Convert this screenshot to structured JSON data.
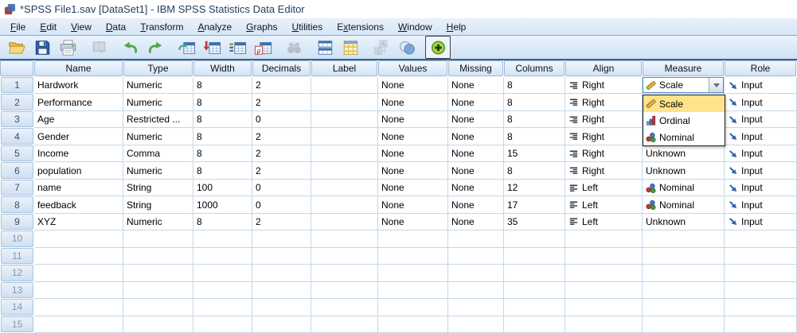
{
  "window": {
    "title": "*SPSS File1.sav [DataSet1] - IBM SPSS Statistics Data Editor",
    "app_icon": "spss-app-icon"
  },
  "menu": {
    "items": [
      {
        "label": "File",
        "underline_index": 0
      },
      {
        "label": "Edit",
        "underline_index": 0
      },
      {
        "label": "View",
        "underline_index": 0
      },
      {
        "label": "Data",
        "underline_index": 0
      },
      {
        "label": "Transform",
        "underline_index": 0
      },
      {
        "label": "Analyze",
        "underline_index": 0
      },
      {
        "label": "Graphs",
        "underline_index": 0
      },
      {
        "label": "Utilities",
        "underline_index": 0
      },
      {
        "label": "Extensions",
        "underline_index": 1
      },
      {
        "label": "Window",
        "underline_index": 0
      },
      {
        "label": "Help",
        "underline_index": 0
      }
    ]
  },
  "toolbar": {
    "buttons": [
      {
        "name": "open-data-button",
        "icon": "open-folder-icon",
        "disabled": false,
        "pressed": false,
        "group_start": false
      },
      {
        "name": "save-button",
        "icon": "save-icon",
        "disabled": false,
        "pressed": false,
        "group_start": false
      },
      {
        "name": "print-button",
        "icon": "print-icon",
        "disabled": false,
        "pressed": false,
        "group_start": false
      },
      {
        "name": "recall-dialogs-button",
        "icon": "recall-dialogs-icon",
        "disabled": true,
        "pressed": false,
        "group_start": true
      },
      {
        "name": "undo-button",
        "icon": "undo-icon",
        "disabled": false,
        "pressed": false,
        "group_start": true
      },
      {
        "name": "redo-button",
        "icon": "redo-icon",
        "disabled": false,
        "pressed": false,
        "group_start": false
      },
      {
        "name": "goto-case-button",
        "icon": "goto-case-icon",
        "disabled": false,
        "pressed": false,
        "group_start": true
      },
      {
        "name": "goto-variable-button",
        "icon": "goto-variable-icon",
        "disabled": false,
        "pressed": false,
        "group_start": false
      },
      {
        "name": "variables-button",
        "icon": "variables-icon",
        "disabled": false,
        "pressed": false,
        "group_start": false
      },
      {
        "name": "descriptives-button",
        "icon": "descriptives-icon",
        "disabled": false,
        "pressed": false,
        "group_start": false
      },
      {
        "name": "find-button",
        "icon": "find-icon",
        "disabled": true,
        "pressed": false,
        "group_start": true
      },
      {
        "name": "split-file-button",
        "icon": "split-file-icon",
        "disabled": false,
        "pressed": false,
        "group_start": true
      },
      {
        "name": "select-cases-button",
        "icon": "select-cases-icon",
        "disabled": false,
        "pressed": false,
        "group_start": false
      },
      {
        "name": "value-labels-button",
        "icon": "value-labels-icon",
        "disabled": true,
        "pressed": false,
        "group_start": true
      },
      {
        "name": "use-variable-sets-button",
        "icon": "use-variable-sets-icon",
        "disabled": false,
        "pressed": false,
        "group_start": false
      },
      {
        "name": "show-all-variables-button",
        "icon": "show-all-variables-icon",
        "disabled": false,
        "pressed": true,
        "group_start": true
      }
    ]
  },
  "grid": {
    "columns": [
      "Name",
      "Type",
      "Width",
      "Decimals",
      "Label",
      "Values",
      "Missing",
      "Columns",
      "Align",
      "Measure",
      "Role"
    ],
    "rows": [
      {
        "number": "1",
        "name": "Hardwork",
        "type": "Numeric",
        "width": "8",
        "decimals": "2",
        "label": "",
        "values": "None",
        "missing": "None",
        "columns": "8",
        "align": "Right",
        "align_icon": "align-right-icon",
        "measure": "Scale",
        "measure_icon": "scale-icon",
        "measure_editor_open": true,
        "role": "Input",
        "role_icon": "input-role-icon"
      },
      {
        "number": "2",
        "name": "Performance",
        "type": "Numeric",
        "width": "8",
        "decimals": "2",
        "label": "",
        "values": "None",
        "missing": "None",
        "columns": "8",
        "align": "Right",
        "align_icon": "align-right-icon",
        "measure": "",
        "measure_icon": null,
        "measure_editor_open": false,
        "role": "Input",
        "role_icon": "input-role-icon"
      },
      {
        "number": "3",
        "name": "Age",
        "type": "Restricted ...",
        "width": "8",
        "decimals": "0",
        "label": "",
        "values": "None",
        "missing": "None",
        "columns": "8",
        "align": "Right",
        "align_icon": "align-right-icon",
        "measure": "",
        "measure_icon": null,
        "measure_editor_open": false,
        "role": "Input",
        "role_icon": "input-role-icon"
      },
      {
        "number": "4",
        "name": "Gender",
        "type": "Numeric",
        "width": "8",
        "decimals": "2",
        "label": "",
        "values": "None",
        "missing": "None",
        "columns": "8",
        "align": "Right",
        "align_icon": "align-right-icon",
        "measure": "",
        "measure_icon": null,
        "measure_editor_open": false,
        "role": "Input",
        "role_icon": "input-role-icon"
      },
      {
        "number": "5",
        "name": "Income",
        "type": "Comma",
        "width": "8",
        "decimals": "2",
        "label": "",
        "values": "None",
        "missing": "None",
        "columns": "15",
        "align": "Right",
        "align_icon": "align-right-icon",
        "measure": "Unknown",
        "measure_icon": null,
        "measure_editor_open": false,
        "role": "Input",
        "role_icon": "input-role-icon"
      },
      {
        "number": "6",
        "name": "population",
        "type": "Numeric",
        "width": "8",
        "decimals": "2",
        "label": "",
        "values": "None",
        "missing": "None",
        "columns": "8",
        "align": "Right",
        "align_icon": "align-right-icon",
        "measure": "Unknown",
        "measure_icon": null,
        "measure_editor_open": false,
        "role": "Input",
        "role_icon": "input-role-icon"
      },
      {
        "number": "7",
        "name": "name",
        "type": "String",
        "width": "100",
        "decimals": "0",
        "label": "",
        "values": "None",
        "missing": "None",
        "columns": "12",
        "align": "Left",
        "align_icon": "align-left-icon",
        "measure": "Nominal",
        "measure_icon": "nominal-icon",
        "measure_editor_open": false,
        "role": "Input",
        "role_icon": "input-role-icon"
      },
      {
        "number": "8",
        "name": "feedback",
        "type": "String",
        "width": "1000",
        "decimals": "0",
        "label": "",
        "values": "None",
        "missing": "None",
        "columns": "17",
        "align": "Left",
        "align_icon": "align-left-icon",
        "measure": "Nominal",
        "measure_icon": "nominal-icon",
        "measure_editor_open": false,
        "role": "Input",
        "role_icon": "input-role-icon"
      },
      {
        "number": "9",
        "name": "XYZ",
        "type": "Numeric",
        "width": "8",
        "decimals": "2",
        "label": "",
        "values": "None",
        "missing": "None",
        "columns": "35",
        "align": "Left",
        "align_icon": "align-left-icon",
        "measure": "Unknown",
        "measure_icon": null,
        "measure_editor_open": false,
        "role": "Input",
        "role_icon": "input-role-icon"
      }
    ],
    "empty_row_numbers": [
      "10",
      "11",
      "12",
      "13",
      "14",
      "15"
    ]
  },
  "measure_editor": {
    "value": "Scale",
    "icon": "scale-icon",
    "dropdown_button_icon": "chevron-down-icon",
    "dropdown": {
      "items": [
        {
          "label": "Scale",
          "icon": "scale-icon",
          "selected": true
        },
        {
          "label": "Ordinal",
          "icon": "ordinal-icon",
          "selected": false
        },
        {
          "label": "Nominal",
          "icon": "nominal-icon",
          "selected": false
        }
      ]
    }
  },
  "colors": {
    "selection_highlight": "#ffe28a",
    "header_fill": "#d9e7f8",
    "grid_line": "#c3d7ea",
    "toolbar_border": "#3a6190",
    "combobox_border": "#4a90d9",
    "input_role_blue": "#2f63b0",
    "scale_gold": "#f0c04a",
    "ordinal_red": "#c03a3a",
    "nominal_green": "#3f9c3f"
  }
}
